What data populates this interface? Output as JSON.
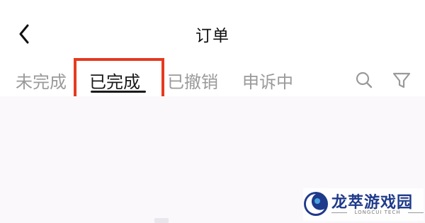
{
  "header": {
    "back_icon": "chevron-left-icon",
    "title": "订单"
  },
  "tabs": [
    {
      "label": "未完成",
      "active": false
    },
    {
      "label": "已完成",
      "active": true
    },
    {
      "label": "已撤销",
      "active": false
    },
    {
      "label": "申诉中",
      "active": false
    }
  ],
  "toolbar": {
    "search_icon": "search-icon",
    "filter_icon": "filter-icon"
  },
  "annotation": {
    "color": "#e5391f"
  },
  "watermark": {
    "title": "龙萃游戏园",
    "subtitle": "LONGCUI TECH"
  },
  "colors": {
    "active_tab": "#1a1a1a",
    "inactive_tab": "#9a9a9a",
    "content_background": "#faf8fb"
  }
}
